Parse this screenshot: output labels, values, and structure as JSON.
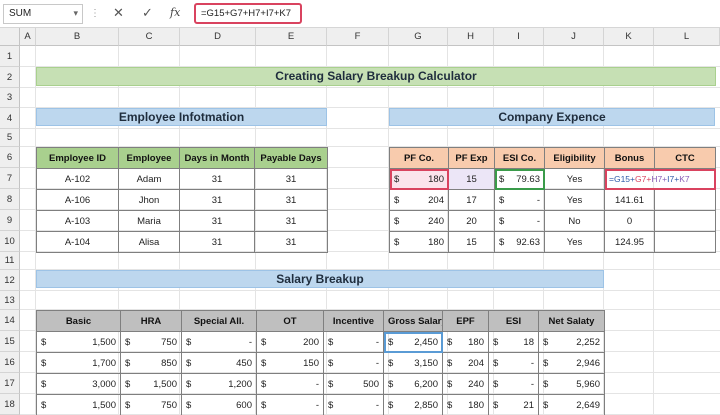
{
  "formula_bar": {
    "name_box": "SUM",
    "formula": "=G15+G7+H7+I7+K7",
    "cancel_icon": "✕",
    "confirm_icon": "✓",
    "fx_label": "fx"
  },
  "columns": [
    "A",
    "B",
    "C",
    "D",
    "E",
    "F",
    "G",
    "H",
    "I",
    "J",
    "K",
    "L"
  ],
  "rows": [
    "1",
    "2",
    "3",
    "4",
    "5",
    "6",
    "7",
    "8",
    "9",
    "10",
    "11",
    "12",
    "13",
    "14",
    "15",
    "16",
    "17",
    "18"
  ],
  "title": "Creating Salary Breakup Calculator",
  "employee_section": {
    "title": "Employee Infotmation",
    "headers": [
      "Employee ID",
      "Employee",
      "Days in Month",
      "Payable Days"
    ],
    "rows": [
      [
        "A-102",
        "Adam",
        "31",
        "31"
      ],
      [
        "A-106",
        "Jhon",
        "31",
        "31"
      ],
      [
        "A-103",
        "Maria",
        "31",
        "31"
      ],
      [
        "A-104",
        "Alisa",
        "31",
        "31"
      ]
    ]
  },
  "company_section": {
    "title": "Company Expence",
    "headers": [
      "PF Co.",
      "PF Exp",
      "ESI Co.",
      "Eligibility",
      "Bonus",
      "CTC"
    ],
    "rows": [
      {
        "pf_cur": "$",
        "pf": "180",
        "pfexp": "15",
        "esi_cur": "$",
        "esi": "79.63",
        "elig": "Yes",
        "bonus": "",
        "ctc": ""
      },
      {
        "pf_cur": "$",
        "pf": "204",
        "pfexp": "17",
        "esi_cur": "$",
        "esi": "-",
        "elig": "Yes",
        "bonus": "141.61",
        "ctc": ""
      },
      {
        "pf_cur": "$",
        "pf": "240",
        "pfexp": "20",
        "esi_cur": "$",
        "esi": "-",
        "elig": "No",
        "bonus": "0",
        "ctc": ""
      },
      {
        "pf_cur": "$",
        "pf": "180",
        "pfexp": "15",
        "esi_cur": "$",
        "esi": "92.63",
        "elig": "Yes",
        "bonus": "124.95",
        "ctc": ""
      }
    ],
    "editing_formula": {
      "p1": "=G15+",
      "p2": "G7+",
      "p3": "H7+",
      "p4": "I7+",
      "p5": "K7"
    }
  },
  "salary_section": {
    "title": "Salary Breakup",
    "headers": [
      "Basic",
      "HRA",
      "Special All.",
      "OT",
      "Incentive",
      "Gross Salary",
      "EPF",
      "ESI",
      "Net Salaty"
    ],
    "rows": [
      [
        "1,500",
        "750",
        "-",
        "200",
        "-",
        "2,450",
        "180",
        "18",
        "2,252"
      ],
      [
        "1,700",
        "850",
        "450",
        "150",
        "-",
        "3,150",
        "204",
        "-",
        "2,946"
      ],
      [
        "3,000",
        "1,500",
        "1,200",
        "-",
        "500",
        "6,200",
        "240",
        "-",
        "5,960"
      ],
      [
        "1,500",
        "750",
        "600",
        "-",
        "-",
        "2,850",
        "180",
        "21",
        "2,649"
      ]
    ],
    "currency": "$"
  },
  "colors": {
    "title_bg": "#c6e0b4",
    "section_bg": "#bdd7ee",
    "employee_header": "#a9d08e",
    "company_header": "#f8cbad",
    "salary_header": "#bfbfbf",
    "ref_red": "#d9435f",
    "ref_green": "#3a9b4a",
    "ref_blue": "#5a9bd5"
  }
}
